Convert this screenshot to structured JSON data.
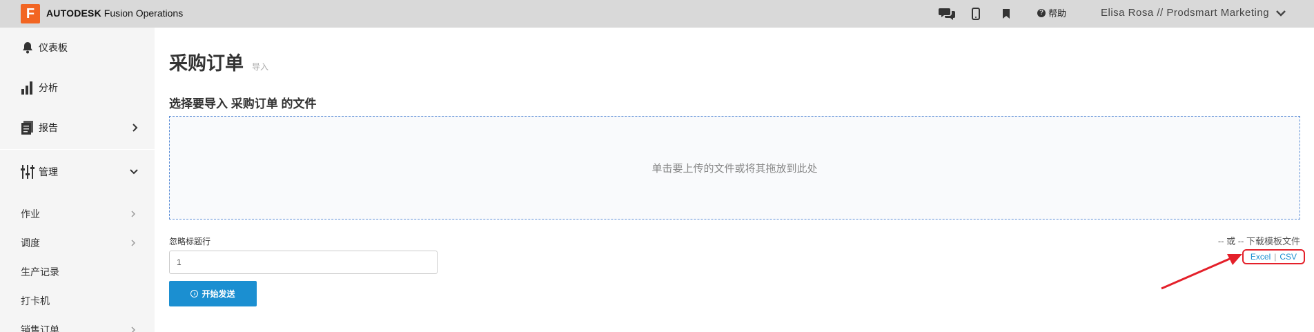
{
  "header": {
    "logo_letter": "F",
    "brand_bold": "AUTODESK",
    "brand_rest": " Fusion Operations",
    "help_label": "帮助",
    "user_label": "Elisa Rosa // Prodsmart Marketing"
  },
  "sidebar": {
    "items": [
      {
        "label": "仪表板",
        "icon": "bell-icon"
      },
      {
        "label": "分析",
        "icon": "bar-chart-icon"
      },
      {
        "label": "报告",
        "icon": "report-icon"
      },
      {
        "label": "管理",
        "icon": "sliders-icon"
      }
    ],
    "sub_items": [
      {
        "label": "作业"
      },
      {
        "label": "调度"
      },
      {
        "label": "生产记录"
      },
      {
        "label": "打卡机"
      },
      {
        "label": "销售订单"
      }
    ]
  },
  "main": {
    "title": "采购订单",
    "subtitle": "导入",
    "section_title": "选择要导入 采购订单 的文件",
    "dropzone_text": "单击要上传的文件或将其拖放到此处",
    "ignore_header_label": "忽略标题行",
    "ignore_header_value": "1",
    "submit_label": "开始发送",
    "or_text": "-- 或 -- 下载模板文件",
    "excel_label": "Excel",
    "csv_label": "CSV",
    "link_separator": "|"
  },
  "colors": {
    "topbar": "#d9d9d9",
    "logo": "#f26522",
    "primary_button": "#1b8fd1",
    "annotation": "#e4202a"
  }
}
